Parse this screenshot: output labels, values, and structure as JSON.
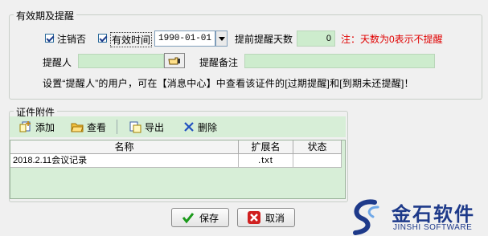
{
  "validity": {
    "group_title": "有效期及提醒",
    "cancelled_label": "注销否",
    "valid_time_label": "有效时间",
    "date_value": "1990-01-01",
    "advance_days_label": "提前提醒天数",
    "advance_days_value": "0",
    "note": "注：天数为0表示不提醒",
    "reminder_person_label": "提醒人",
    "reminder_person_value": "",
    "reminder_note_label": "提醒备注",
    "reminder_note_value": "",
    "info_text": "设置“提醒人”的用户，可在【消息中心】中查看该证件的[过期提醒]和[到期未还提醒]！"
  },
  "attachments": {
    "group_title": "证件附件",
    "toolbar": {
      "add": "添加",
      "view": "查看",
      "export": "导出",
      "delete": "删除"
    },
    "columns": [
      "名称",
      "扩展名",
      "状态"
    ],
    "rows": [
      {
        "name": "2018.2.11会议记录",
        "ext": ".txt",
        "status": ""
      }
    ]
  },
  "buttons": {
    "save": "保存",
    "cancel": "取消"
  },
  "logo": {
    "cn": "金石软件",
    "en": "JINSHI SOFTWARE"
  },
  "colors": {
    "note_red": "#e00000",
    "field_green": "#cdeccd",
    "table_green": "#d7eed7",
    "logo_blue": "#1e3a8a"
  }
}
